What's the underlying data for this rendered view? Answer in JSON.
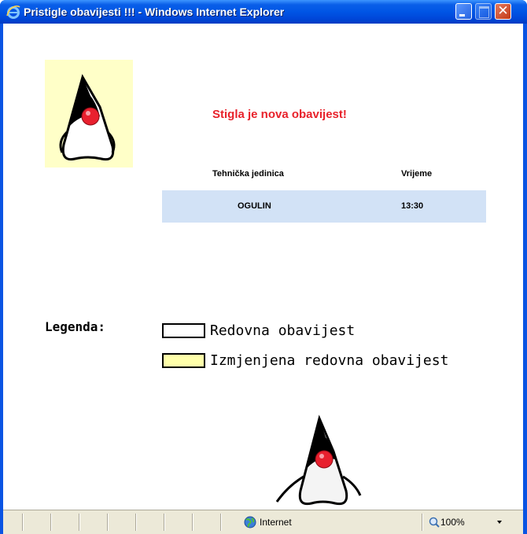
{
  "window": {
    "title": "Pristigle obavijesti !!! - Windows Internet Explorer",
    "logo_icon": "ie-logo-icon",
    "controls": [
      "minimize-icon",
      "maximize-icon",
      "close-icon"
    ]
  },
  "page": {
    "mascot_icon": "java-duke-icon",
    "notice": "Stigla je nova obavijest!",
    "notice_color": "#e8222b",
    "table": {
      "headers": [
        "Tehnička jedinica",
        "Vrijeme"
      ],
      "rows": [
        [
          "OGULIN",
          "13:30"
        ]
      ],
      "row_color": "#d2e2f6"
    },
    "legend": {
      "title": "Legenda:",
      "items": [
        {
          "label": "Redovna obavijest",
          "color": "#ffffff"
        },
        {
          "label": "Izmjenjena redovna obavijest",
          "color": "#ffffaa"
        }
      ]
    },
    "mascot_box_color": "#ffffc8"
  },
  "statusbar": {
    "zone_icon": "globe-icon",
    "zone": "Internet",
    "zoom_icon": "zoom-icon",
    "zoom": "100%"
  }
}
